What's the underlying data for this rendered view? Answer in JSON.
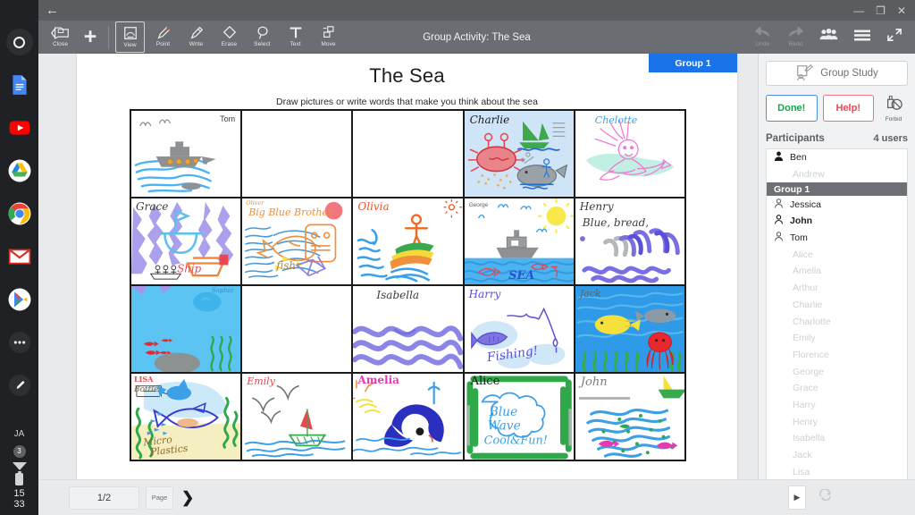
{
  "launcher": {
    "items": [
      {
        "name": "home-circle-icon",
        "label": "Home"
      },
      {
        "name": "docs-icon",
        "label": "Docs"
      },
      {
        "name": "youtube-icon",
        "label": "YouTube"
      },
      {
        "name": "drive-icon",
        "label": "Drive"
      },
      {
        "name": "chrome-icon",
        "label": "Chrome"
      },
      {
        "name": "gmail-icon",
        "label": "Gmail"
      },
      {
        "name": "play-store-icon",
        "label": "Play Store"
      },
      {
        "name": "more-apps-icon",
        "label": "More"
      },
      {
        "name": "stylus-icon",
        "label": "Stylus"
      }
    ],
    "status": {
      "input_method": "JA",
      "notification_count": "3",
      "time_hour": "15",
      "time_minute": "33"
    }
  },
  "titlebar": {
    "back_label": "←",
    "minimize": "—",
    "maximize": "❐",
    "close": "✕"
  },
  "toolbar": {
    "document_title": "Group Activity: The Sea",
    "close_label": "Close",
    "add_label": "+",
    "tools": [
      {
        "label": "View",
        "icon": "view-icon",
        "selected": true
      },
      {
        "label": "Point",
        "icon": "pointer-pen-icon",
        "selected": false
      },
      {
        "label": "Write",
        "icon": "write-pen-icon",
        "selected": false
      },
      {
        "label": "Erase",
        "icon": "eraser-icon",
        "selected": false
      },
      {
        "label": "Select",
        "icon": "lasso-select-icon",
        "selected": false
      },
      {
        "label": "Text",
        "icon": "text-icon",
        "selected": false
      },
      {
        "label": "Move",
        "icon": "move-icon",
        "selected": false
      }
    ],
    "right_tools": [
      {
        "label": "Undo",
        "icon": "undo-icon"
      },
      {
        "label": "Redo",
        "icon": "redo-icon"
      }
    ],
    "right_icons": [
      {
        "name": "participants-icon"
      },
      {
        "name": "hamburger-menu-icon"
      },
      {
        "name": "fullscreen-icon"
      }
    ]
  },
  "page": {
    "title": "The Sea",
    "subtitle": "Draw pictures or write words that make you think about the sea",
    "group_chip": "Group 1"
  },
  "cells": [
    {
      "author": "Tom",
      "style": "typed",
      "empty": false
    },
    {
      "author": "",
      "style": "none",
      "empty": true
    },
    {
      "author": "",
      "style": "none",
      "empty": true
    },
    {
      "author": "Charlie",
      "style": "hand",
      "empty": false
    },
    {
      "author": "Chelotte",
      "style": "hand",
      "empty": false
    },
    {
      "author": "Grace",
      "style": "hand",
      "empty": false
    },
    {
      "author": "Oliver",
      "style": "hand",
      "empty": false,
      "note": "Big Blue Brother",
      "note2": "fish"
    },
    {
      "author": "Olivia",
      "style": "hand",
      "empty": false
    },
    {
      "author": "George",
      "style": "typed",
      "empty": false,
      "note": "SEA"
    },
    {
      "author": "Henry",
      "style": "hand",
      "empty": false,
      "note": "Blue, bread,"
    },
    {
      "author": "Sophia",
      "style": "hand",
      "empty": false
    },
    {
      "author": "",
      "style": "none",
      "empty": true
    },
    {
      "author": "Isabella",
      "style": "hand",
      "empty": false
    },
    {
      "author": "Harry",
      "style": "hand",
      "empty": false,
      "note": "Fishing!"
    },
    {
      "author": "Jack",
      "style": "hand",
      "empty": false
    },
    {
      "author": "LISA",
      "style": "hand",
      "empty": false,
      "note": "Bottle",
      "note2": "Micro Plastics"
    },
    {
      "author": "Emily",
      "style": "hand",
      "empty": false
    },
    {
      "author": "Amelia",
      "style": "hand",
      "empty": false
    },
    {
      "author": "Alice",
      "style": "hand",
      "empty": false,
      "note": "Blue",
      "note2": "Wave",
      "note3": "Cool & Fun!"
    },
    {
      "author": "John",
      "style": "hand",
      "empty": false
    }
  ],
  "rpanel": {
    "group_study_label": "Group Study",
    "group_study_icon": "group-study-icon",
    "done_label": "Done!",
    "help_label": "Help!",
    "forbid_label": "Forbid",
    "participants_label": "Participants",
    "user_count": "4 users",
    "rows": [
      {
        "text": "Ben",
        "kind": "active",
        "avatar": "solid"
      },
      {
        "text": "Andrew",
        "kind": "dim"
      },
      {
        "text": "Group 1",
        "kind": "group"
      },
      {
        "text": "Jessica",
        "kind": "active",
        "avatar": "outline"
      },
      {
        "text": "John",
        "kind": "bold",
        "avatar": "outline"
      },
      {
        "text": "Tom",
        "kind": "active",
        "avatar": "outline"
      },
      {
        "text": "Alice",
        "kind": "dim"
      },
      {
        "text": "Amelia",
        "kind": "dim"
      },
      {
        "text": "Arthur",
        "kind": "dim"
      },
      {
        "text": "Charlie",
        "kind": "dim"
      },
      {
        "text": "Charlotte",
        "kind": "dim"
      },
      {
        "text": "Emily",
        "kind": "dim"
      },
      {
        "text": "Florence",
        "kind": "dim"
      },
      {
        "text": "George",
        "kind": "dim"
      },
      {
        "text": "Grace",
        "kind": "dim"
      },
      {
        "text": "Harry",
        "kind": "dim"
      },
      {
        "text": "Henry",
        "kind": "dim"
      },
      {
        "text": "Isabella",
        "kind": "dim"
      },
      {
        "text": "Jack",
        "kind": "dim"
      },
      {
        "text": "Lisa",
        "kind": "dim"
      }
    ]
  },
  "bottombar": {
    "page_indicator": "1/2",
    "page_label": "Page",
    "next_label": "❯",
    "play_label": "▶",
    "refresh_icon": "refresh-icon"
  },
  "colors": {
    "accent_blue": "#1a73e8",
    "toolbar_gray": "#6a6d72",
    "titlebar_gray": "#5a5c60",
    "panel_bg": "#f1f2f3",
    "group_header": "#6d7075",
    "done_green": "#15a54a",
    "help_red": "#e8484f"
  }
}
